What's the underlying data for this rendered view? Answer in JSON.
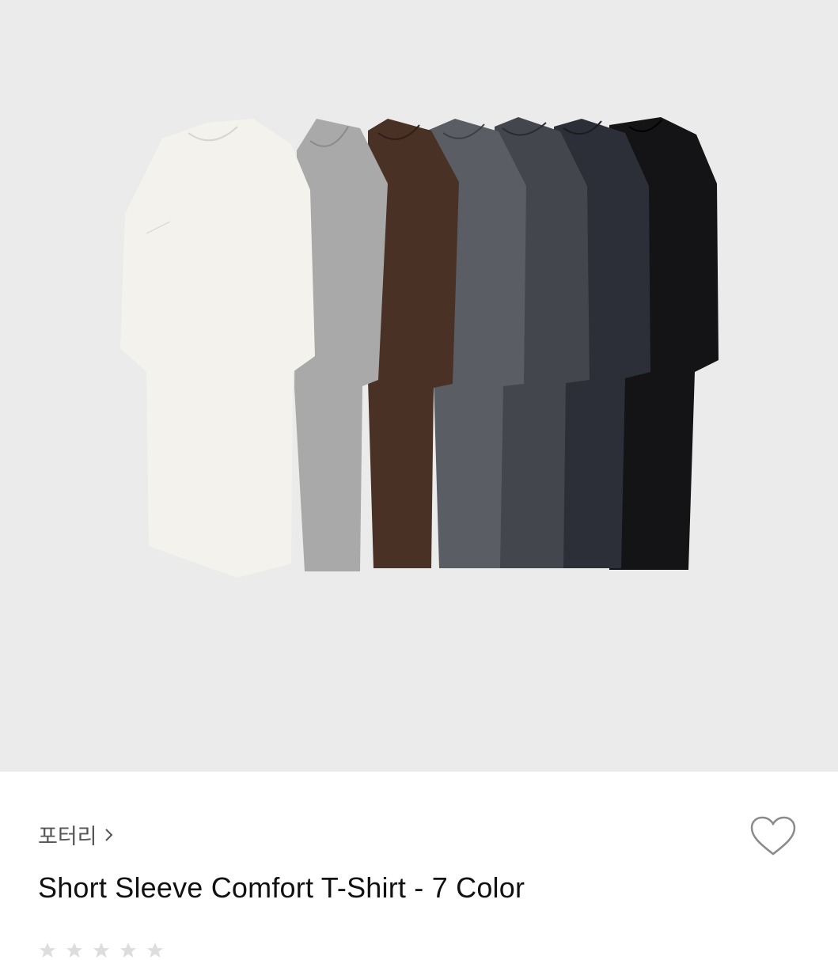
{
  "product": {
    "image": {
      "name": "tshirt-product-photo",
      "colors": [
        "#f4f2ec",
        "#a9a9a9",
        "#4a3126",
        "#5a5d64",
        "#43464d",
        "#2c2f38",
        "#141416"
      ]
    },
    "brand": {
      "name": "포터리",
      "chevron_icon": "chevron-right-icon"
    },
    "wishlist_icon": "heart-outline-icon",
    "title": "Short Sleeve Comfort T-Shirt - 7 Color",
    "rating": {
      "star_icon": "star-icon",
      "max": 5
    }
  },
  "theme": {
    "hero_background": "#ebebeb",
    "text_primary": "#111111",
    "text_secondary": "#555555",
    "icon_stroke": "#8a8a8a"
  }
}
